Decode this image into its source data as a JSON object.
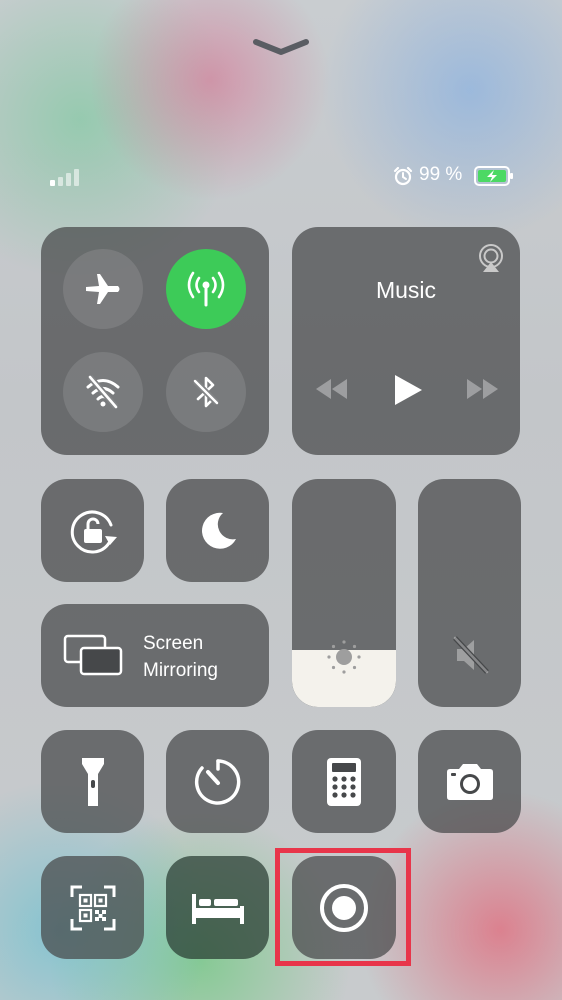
{
  "status_bar": {
    "battery_text": "99 %",
    "alarm_icon": "alarm-clock-icon",
    "battery_color": "#4cd964"
  },
  "connectivity": {
    "airplane_mode": {
      "icon": "airplane-icon",
      "on": false
    },
    "cellular_data": {
      "icon": "antenna-icon",
      "on": true,
      "color": "#3dcb58"
    },
    "wifi": {
      "icon": "wifi-off-icon",
      "on": false
    },
    "bluetooth": {
      "icon": "bluetooth-off-icon",
      "on": false
    }
  },
  "music": {
    "title": "Music",
    "airplay_icon": "airplay-icon"
  },
  "screen_mirroring": {
    "line1": "Screen",
    "line2": "Mirroring"
  },
  "sliders": {
    "brightness": {
      "level": 0.25
    },
    "volume": {
      "level": 0.0,
      "muted": true
    }
  },
  "highlight_color": "#e8354a"
}
